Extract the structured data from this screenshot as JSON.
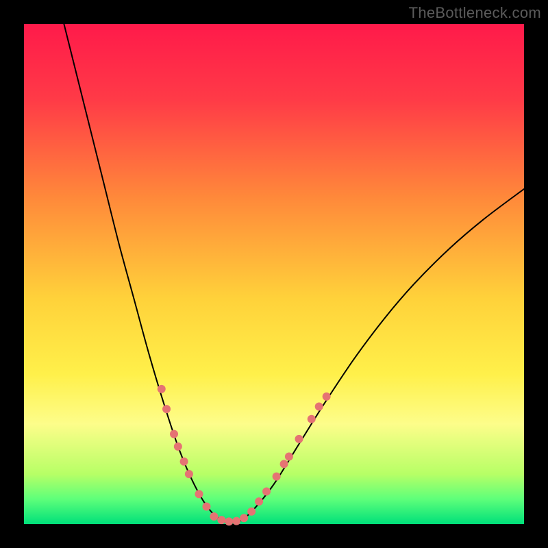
{
  "watermark": "TheBottleneck.com",
  "chart_data": {
    "type": "line",
    "title": "",
    "xlabel": "",
    "ylabel": "",
    "xlim": [
      0,
      100
    ],
    "ylim": [
      0,
      100
    ],
    "background_gradient": {
      "stops": [
        {
          "offset": 0.0,
          "color": "#ff1a4a"
        },
        {
          "offset": 0.15,
          "color": "#ff3a47"
        },
        {
          "offset": 0.35,
          "color": "#ff8a3a"
        },
        {
          "offset": 0.55,
          "color": "#ffd23a"
        },
        {
          "offset": 0.7,
          "color": "#fff04a"
        },
        {
          "offset": 0.8,
          "color": "#fdfd8a"
        },
        {
          "offset": 0.9,
          "color": "#b7ff66"
        },
        {
          "offset": 0.95,
          "color": "#5eff7a"
        },
        {
          "offset": 1.0,
          "color": "#00e07a"
        }
      ]
    },
    "series": [
      {
        "name": "bottleneck-curve",
        "color": "#000000",
        "width": 2,
        "points": [
          {
            "x": 8,
            "y": 100
          },
          {
            "x": 10,
            "y": 92
          },
          {
            "x": 13,
            "y": 80
          },
          {
            "x": 16,
            "y": 68
          },
          {
            "x": 19,
            "y": 56
          },
          {
            "x": 22,
            "y": 45
          },
          {
            "x": 25,
            "y": 34
          },
          {
            "x": 28,
            "y": 24
          },
          {
            "x": 31,
            "y": 15
          },
          {
            "x": 34,
            "y": 8
          },
          {
            "x": 37,
            "y": 3
          },
          {
            "x": 40,
            "y": 0.5
          },
          {
            "x": 43,
            "y": 0.5
          },
          {
            "x": 46,
            "y": 3
          },
          {
            "x": 50,
            "y": 8
          },
          {
            "x": 55,
            "y": 16
          },
          {
            "x": 60,
            "y": 24
          },
          {
            "x": 66,
            "y": 33
          },
          {
            "x": 72,
            "y": 41
          },
          {
            "x": 78,
            "y": 48
          },
          {
            "x": 85,
            "y": 55
          },
          {
            "x": 92,
            "y": 61
          },
          {
            "x": 100,
            "y": 67
          }
        ]
      }
    ],
    "markers": {
      "color": "#e57373",
      "radius": 6,
      "points": [
        {
          "x": 27.5,
          "y": 27
        },
        {
          "x": 28.5,
          "y": 23
        },
        {
          "x": 30.0,
          "y": 18
        },
        {
          "x": 30.8,
          "y": 15.5
        },
        {
          "x": 32.0,
          "y": 12.5
        },
        {
          "x": 33.0,
          "y": 10
        },
        {
          "x": 35.0,
          "y": 6
        },
        {
          "x": 36.5,
          "y": 3.5
        },
        {
          "x": 38.0,
          "y": 1.5
        },
        {
          "x": 39.5,
          "y": 0.8
        },
        {
          "x": 41.0,
          "y": 0.5
        },
        {
          "x": 42.5,
          "y": 0.6
        },
        {
          "x": 44.0,
          "y": 1.2
        },
        {
          "x": 45.5,
          "y": 2.5
        },
        {
          "x": 47.0,
          "y": 4.5
        },
        {
          "x": 48.5,
          "y": 6.5
        },
        {
          "x": 50.5,
          "y": 9.5
        },
        {
          "x": 52.0,
          "y": 12
        },
        {
          "x": 53.0,
          "y": 13.5
        },
        {
          "x": 55.0,
          "y": 17
        },
        {
          "x": 57.5,
          "y": 21
        },
        {
          "x": 59.0,
          "y": 23.5
        },
        {
          "x": 60.5,
          "y": 25.5
        }
      ]
    }
  }
}
